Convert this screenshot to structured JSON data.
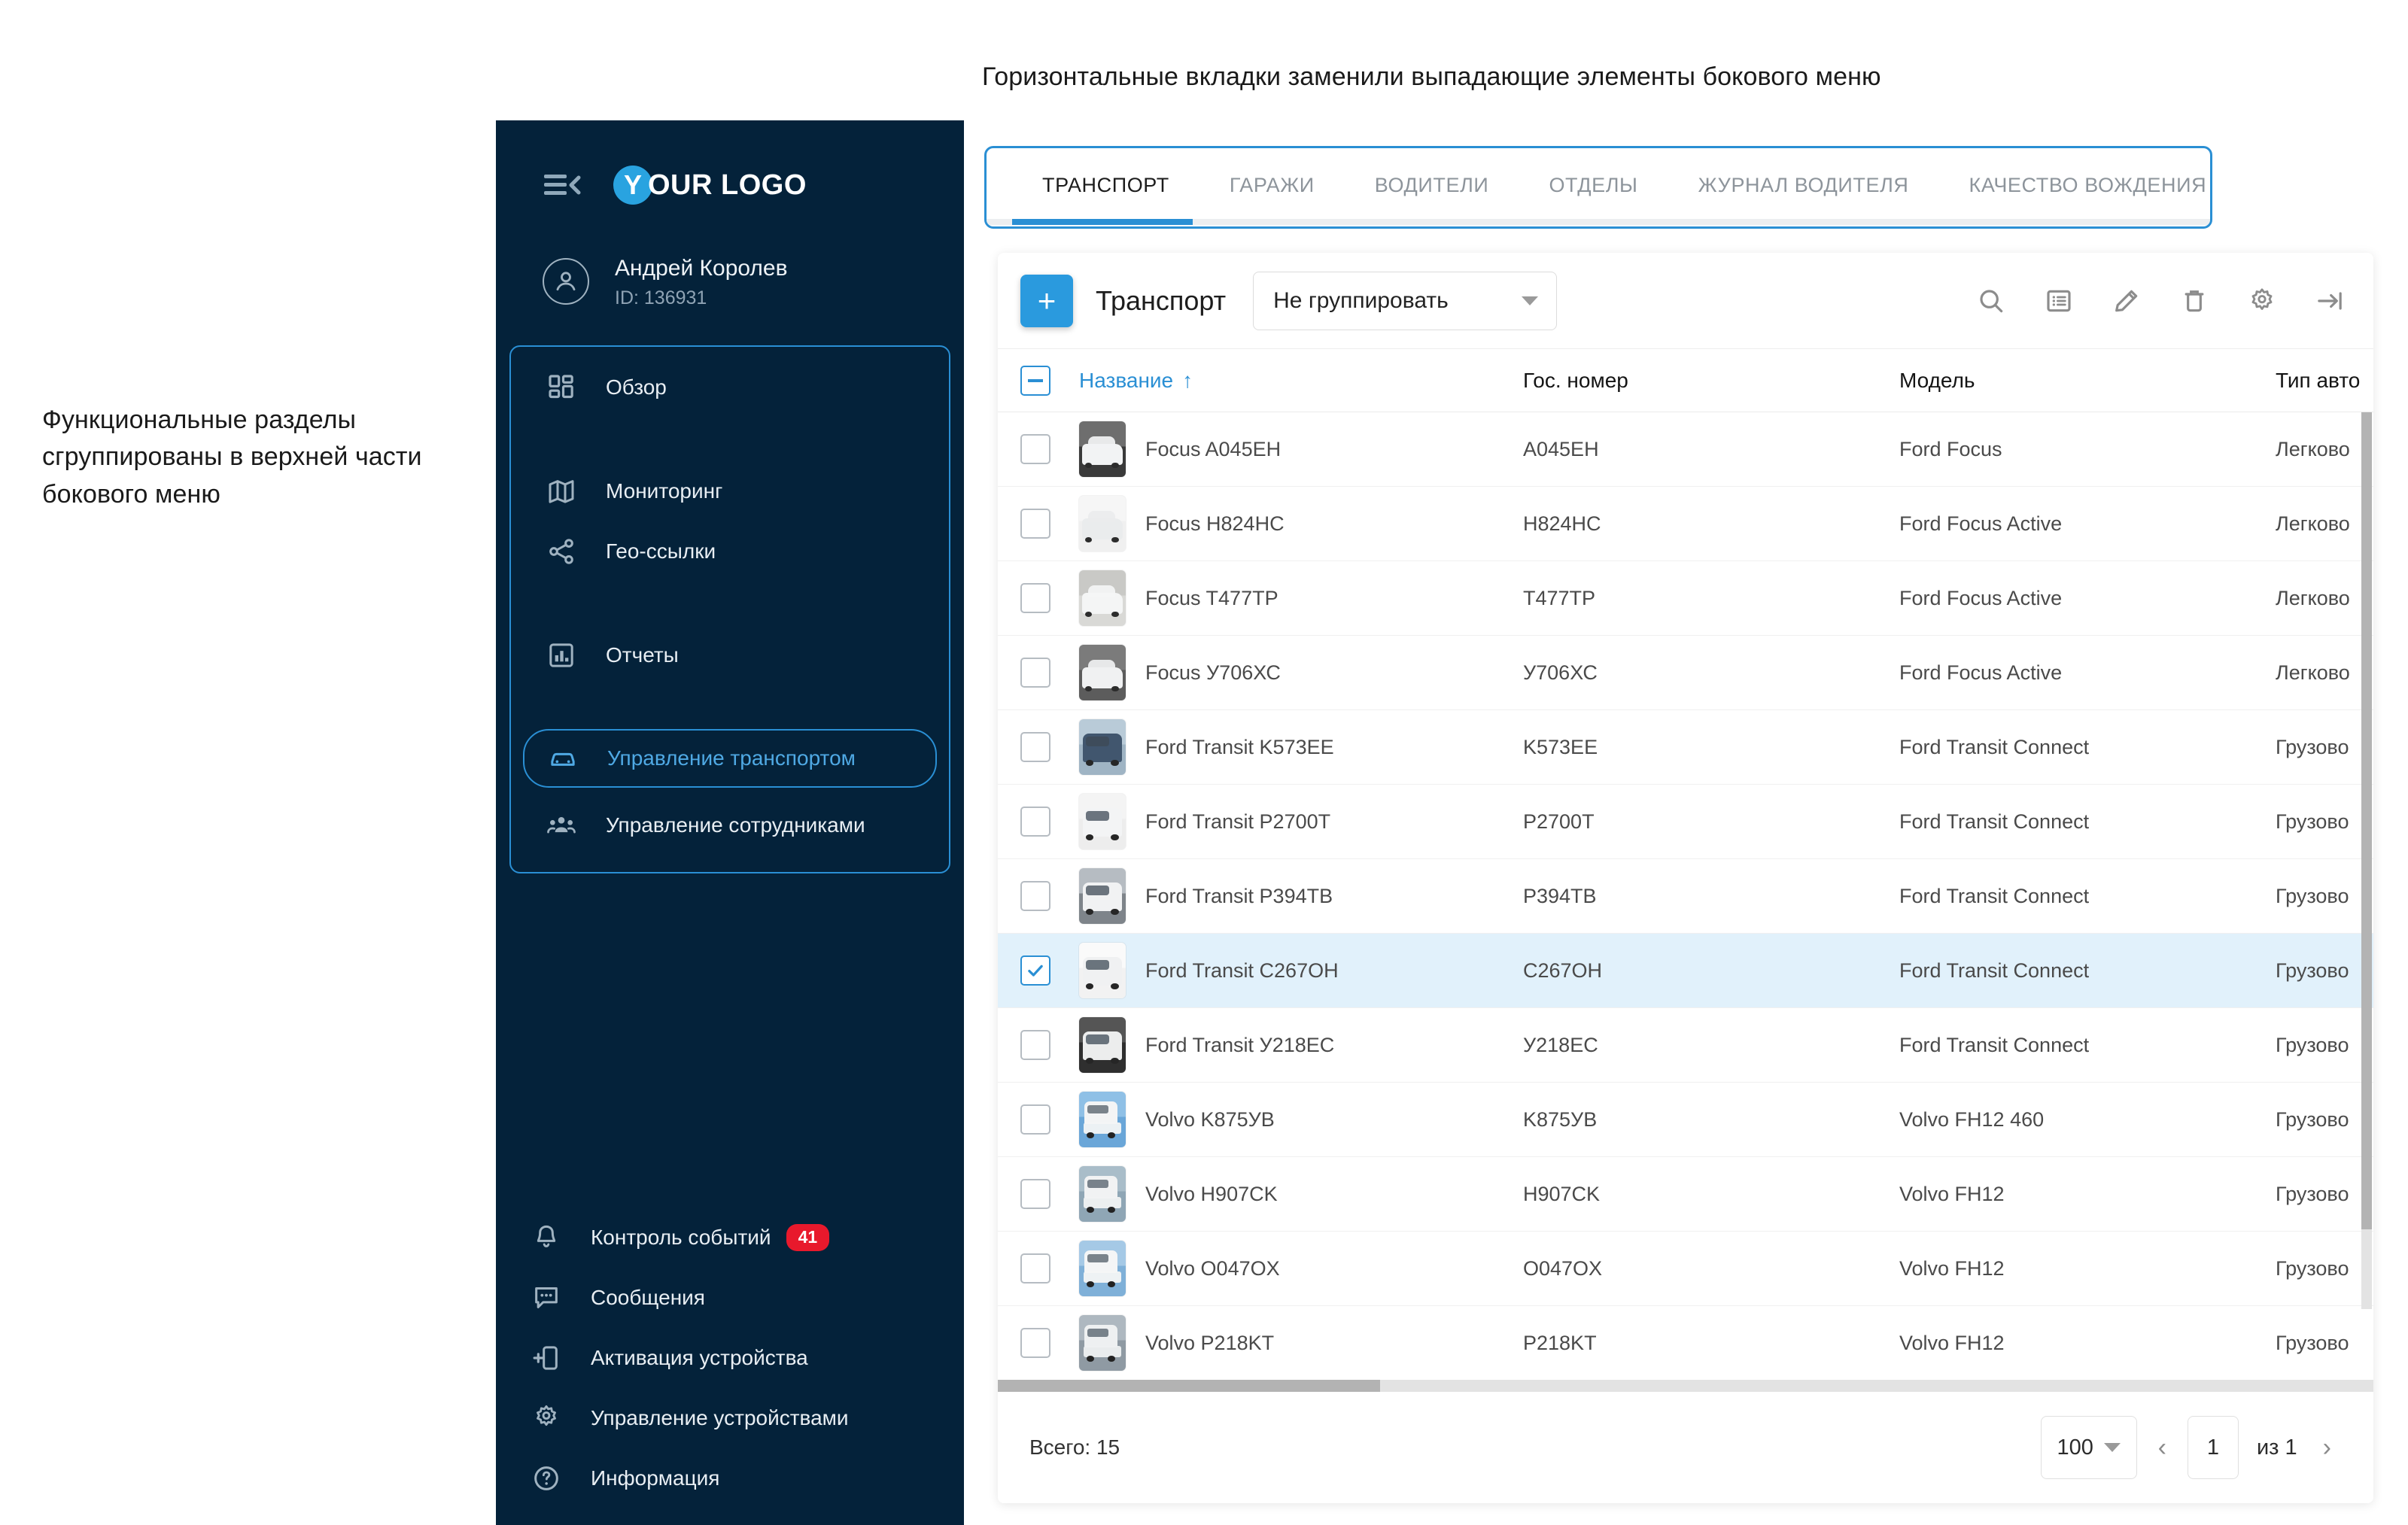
{
  "annotations": {
    "left": "Функциональные разделы сгруппированы в верхней части бокового меню",
    "top": "Горизонтальные вкладки заменили выпадающие элементы бокового меню"
  },
  "colors": {
    "sidebar_bg": "#04223a",
    "accent": "#2a8fd4",
    "add_button": "#2a9ade",
    "badge_red": "#e8192c",
    "selected_row": "#e1f1fb"
  },
  "sidebar": {
    "logo": {
      "mark": "Y",
      "text": "OUR LOGO"
    },
    "burger_icon": "collapse-menu-icon",
    "user": {
      "name": "Андрей Королев",
      "id": "ID: 136931"
    },
    "group_items": [
      {
        "label": "Обзор",
        "icon": "dashboard-icon",
        "active": false
      },
      {
        "label": "Мониторинг",
        "icon": "map-icon",
        "active": false
      },
      {
        "label": "Гео-ссылки",
        "icon": "share-icon",
        "active": false
      },
      {
        "label": "Отчеты",
        "icon": "bar-chart-icon",
        "active": false
      },
      {
        "label": "Управление транспортом",
        "icon": "car-icon",
        "active": true
      },
      {
        "label": "Управление сотрудниками",
        "icon": "people-icon",
        "active": false
      }
    ],
    "bottom_items": [
      {
        "label": "Контроль событий",
        "icon": "bell-icon",
        "badge": "41"
      },
      {
        "label": "Сообщения",
        "icon": "chat-icon",
        "badge": ""
      },
      {
        "label": "Активация устройства",
        "icon": "device-add-icon",
        "badge": ""
      },
      {
        "label": "Управление устройствами",
        "icon": "gear-icon",
        "badge": ""
      },
      {
        "label": "Информация",
        "icon": "help-circle-icon",
        "badge": ""
      }
    ]
  },
  "tabs": [
    {
      "label": "ТРАНСПОРТ",
      "active": true
    },
    {
      "label": "ГАРАЖИ",
      "active": false
    },
    {
      "label": "ВОДИТЕЛИ",
      "active": false
    },
    {
      "label": "ОТДЕЛЫ",
      "active": false
    },
    {
      "label": "ЖУРНАЛ ВОДИТЕЛЯ",
      "active": false
    },
    {
      "label": "КАЧЕСТВО ВОЖДЕНИЯ",
      "active": false
    }
  ],
  "toolbar": {
    "add_label": "+",
    "title": "Транспорт",
    "group_by_value": "Не группировать",
    "icons": [
      "search-icon",
      "list-view-icon",
      "pencil-icon",
      "trash-icon",
      "gear-icon",
      "collapse-right-icon"
    ]
  },
  "table": {
    "columns": [
      "Название",
      "Гос. номер",
      "Модель",
      "Тип авто"
    ],
    "sort_column": "Название",
    "sort_direction": "↑",
    "rows": [
      {
        "name": "Focus A045EH",
        "plate": "A045EH",
        "model": "Ford Focus",
        "type": "Легково",
        "selected": false,
        "thumb": "car-white-front"
      },
      {
        "name": "Focus H824HC",
        "plate": "H824HC",
        "model": "Ford Focus Active",
        "type": "Легково",
        "selected": false,
        "thumb": "car-white-side"
      },
      {
        "name": "Focus T477TP",
        "plate": "T477TP",
        "model": "Ford Focus Active",
        "type": "Легково",
        "selected": false,
        "thumb": "car-white-garage"
      },
      {
        "name": "Focus У706ХС",
        "plate": "У706ХС",
        "model": "Ford Focus Active",
        "type": "Легково",
        "selected": false,
        "thumb": "car-white-dark"
      },
      {
        "name": "Ford Transit K573EE",
        "plate": "K573EE",
        "model": "Ford Transit Connect",
        "type": "Грузово",
        "selected": false,
        "thumb": "van-blue"
      },
      {
        "name": "Ford Transit P2700T",
        "plate": "P2700T",
        "model": "Ford Transit Connect",
        "type": "Грузово",
        "selected": false,
        "thumb": "van-white-tall"
      },
      {
        "name": "Ford Transit P394TB",
        "plate": "P394TB",
        "model": "Ford Transit Connect",
        "type": "Грузово",
        "selected": false,
        "thumb": "van-white-road"
      },
      {
        "name": "Ford Transit C267OH",
        "plate": "C267OH",
        "model": "Ford Transit Connect",
        "type": "Грузово",
        "selected": true,
        "thumb": "van-white-plain"
      },
      {
        "name": "Ford Transit У218ЕС",
        "plate": "У218ЕС",
        "model": "Ford Transit Connect",
        "type": "Грузово",
        "selected": false,
        "thumb": "van-white-dark"
      },
      {
        "name": "Volvo K875УВ",
        "plate": "K875УВ",
        "model": "Volvo FH12 460",
        "type": "Грузово",
        "selected": false,
        "thumb": "truck-sky"
      },
      {
        "name": "Volvo H907CK",
        "plate": "H907CK",
        "model": "Volvo FH12",
        "type": "Грузово",
        "selected": false,
        "thumb": "truck-yard"
      },
      {
        "name": "Volvo O047OX",
        "plate": "O047OX",
        "model": "Volvo FH12",
        "type": "Грузово",
        "selected": false,
        "thumb": "truck-trailer"
      },
      {
        "name": "Volvo P218KT",
        "plate": "P218KT",
        "model": "Volvo FH12",
        "type": "Грузово",
        "selected": false,
        "thumb": "truck-front"
      }
    ]
  },
  "footer": {
    "total": "Всего: 15",
    "per_page": "100",
    "page": "1",
    "of_label": "из 1",
    "prev_icon": "chevron-left-icon",
    "next_icon": "chevron-right-icon"
  }
}
